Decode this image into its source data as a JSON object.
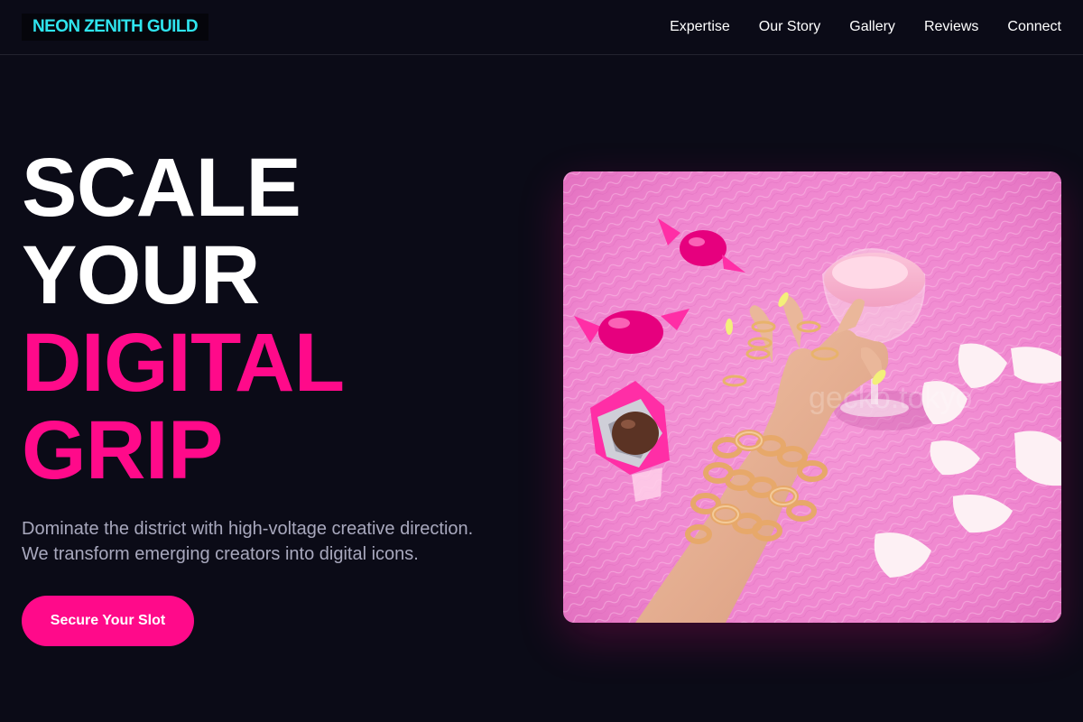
{
  "brand": {
    "name": "NEON ZENITH GUILD",
    "color": "#2fe4ee"
  },
  "nav": {
    "items": [
      {
        "label": "Expertise"
      },
      {
        "label": "Our Story"
      },
      {
        "label": "Gallery"
      },
      {
        "label": "Reviews"
      },
      {
        "label": "Connect"
      }
    ]
  },
  "hero": {
    "headline": {
      "line1": "SCALE",
      "line2": "YOUR",
      "line3": "DIGITAL",
      "line4": "GRIP"
    },
    "subtext": {
      "line1": "Dominate the district with high-voltage creative direction.",
      "line2": "We transform emerging creators into digital icons."
    },
    "cta_label": "Secure Your Slot",
    "image": {
      "alt": "Hand with gold rings and chain bracelets reaching for a pink drink on pink fur, with pink candies and white petals",
      "watermark": "gecko.tokyo"
    }
  },
  "colors": {
    "background": "#0b0b17",
    "accent_pink": "#ff0a8a",
    "text_white": "#ffffff",
    "text_muted": "#a8a8bd"
  }
}
